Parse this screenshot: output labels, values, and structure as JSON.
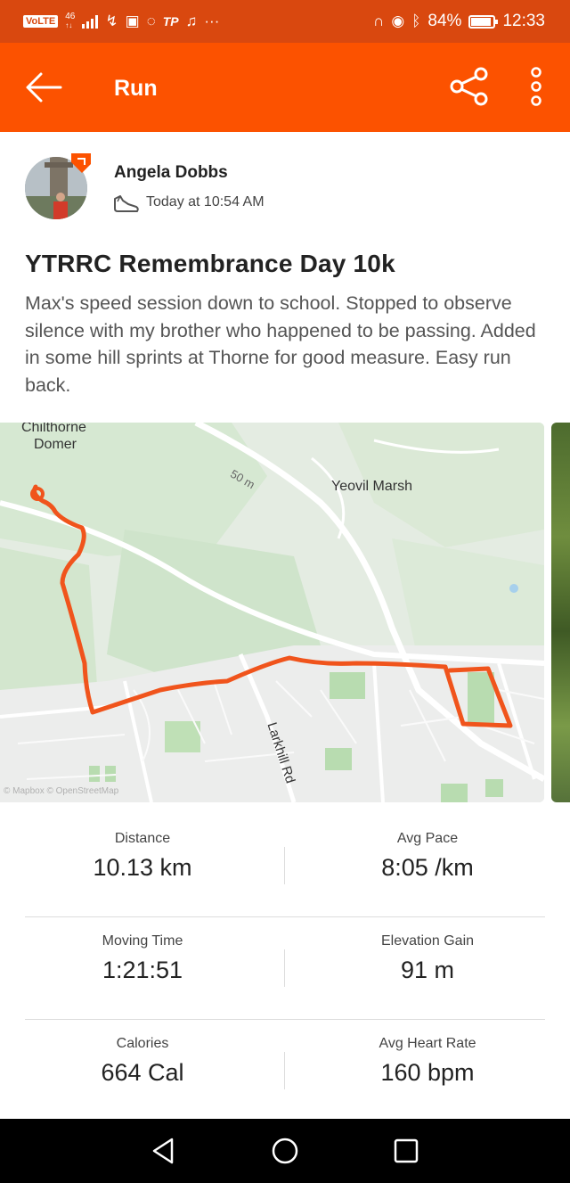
{
  "status_bar": {
    "volte": "VoLTE",
    "network": "46",
    "battery": "84%",
    "time": "12:33",
    "left_icons": [
      "signal-icon",
      "data-arrow-icon",
      "app-icon",
      "sync-icon",
      "tp-icon",
      "music-icon",
      "more-dots-icon"
    ],
    "right_icons": [
      "headphones-icon",
      "eye-icon",
      "bluetooth-icon",
      "battery-icon"
    ]
  },
  "app_bar": {
    "title": "Run",
    "color": "#fc5200"
  },
  "athlete": {
    "name": "Angela Dobbs",
    "time": "Today at 10:54 AM"
  },
  "activity": {
    "title": "YTRRC Remembrance Day 10k",
    "description": "Max's speed session down to school. Stopped to observe silence with my brother who happened to be passing. Added in some hill sprints at Thorne for good measure. Easy run back."
  },
  "map": {
    "labels": {
      "place1_line1": "Chilthorne",
      "place1_line2": "Domer",
      "place2": "Yeovil Marsh",
      "road": "Larkhill Rd",
      "contour": "50 m",
      "attribution": "© Mapbox © OpenStreetMap"
    },
    "route_color": "#f0541c"
  },
  "stats": {
    "distance": {
      "label": "Distance",
      "value": "10.13 km"
    },
    "avg_pace": {
      "label": "Avg Pace",
      "value": "8:05 /km"
    },
    "moving_time": {
      "label": "Moving Time",
      "value": "1:21:51"
    },
    "elevation_gain": {
      "label": "Elevation Gain",
      "value": "91 m"
    },
    "calories": {
      "label": "Calories",
      "value": "664 Cal"
    },
    "avg_heart_rate": {
      "label": "Avg Heart Rate",
      "value": "160 bpm"
    }
  }
}
